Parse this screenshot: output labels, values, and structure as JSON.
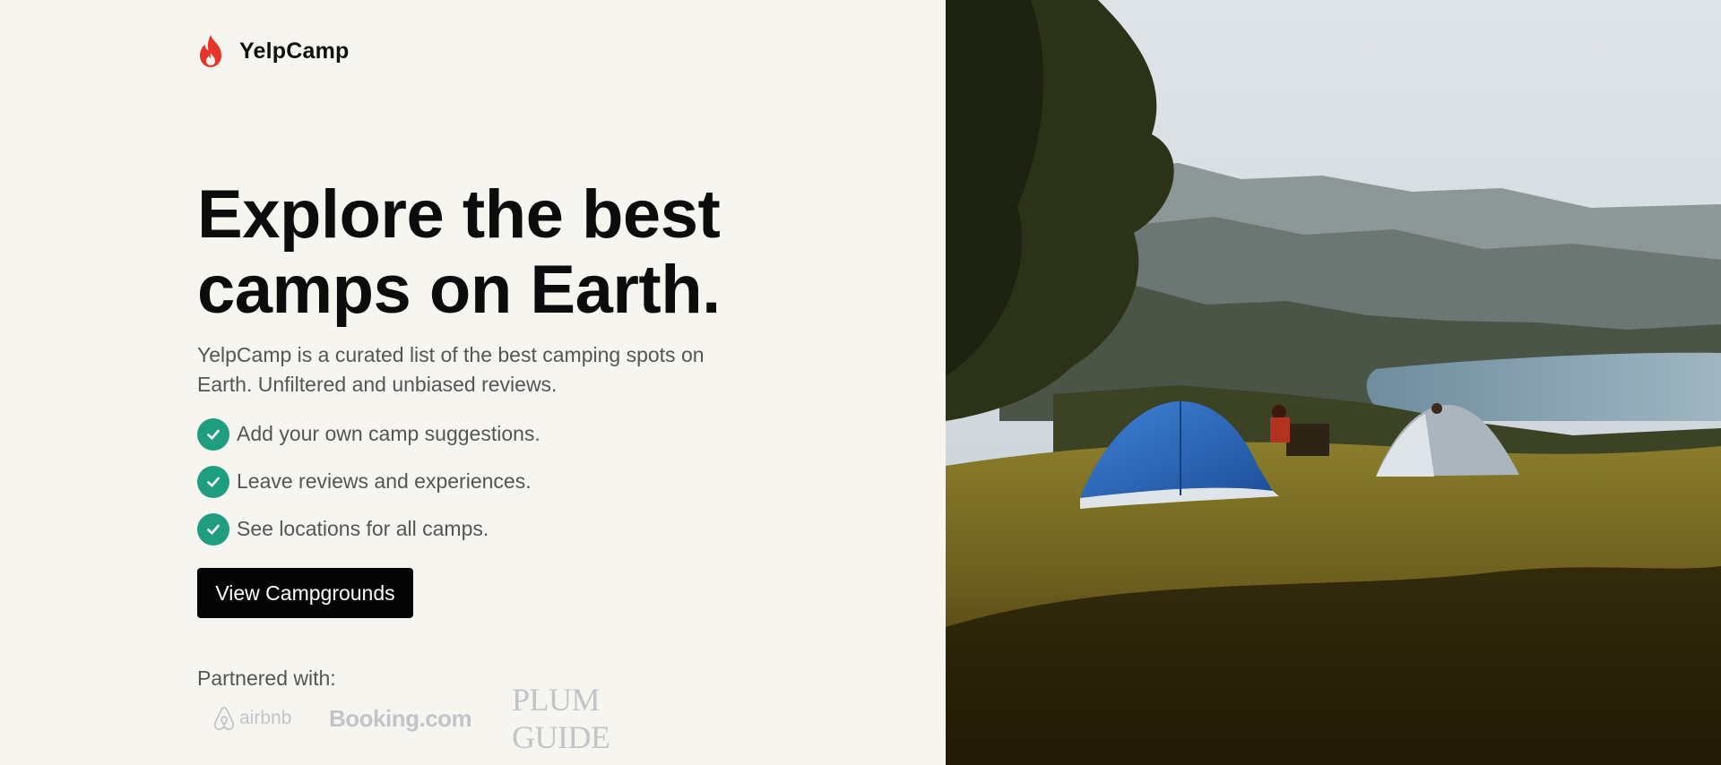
{
  "brand": {
    "name": "YelpCamp",
    "icon": "flame-icon",
    "icon_color": "#e5352b"
  },
  "hero": {
    "headline_line1": "Explore the best",
    "headline_line2": "camps on Earth.",
    "description": "YelpCamp is a curated list of the best camping spots on Earth. Unfiltered and unbiased reviews."
  },
  "features": [
    {
      "label": "Add your own camp suggestions.",
      "icon": "check-circle-icon"
    },
    {
      "label": "Leave reviews and experiences.",
      "icon": "check-circle-icon"
    },
    {
      "label": "See locations for all camps.",
      "icon": "check-circle-icon"
    }
  ],
  "cta": {
    "label": "View Campgrounds"
  },
  "partners": {
    "heading": "Partnered with:",
    "logos": [
      "airbnb",
      "Booking.com",
      "PLUM GUIDE"
    ]
  },
  "hero_image": {
    "subject": "tents-on-hill-photo"
  },
  "colors": {
    "background": "#f7f5f0",
    "accent_green": "#1f9e7f",
    "button": "#050505",
    "text_muted": "#555555",
    "partner_logo": "#c2c4c8"
  }
}
